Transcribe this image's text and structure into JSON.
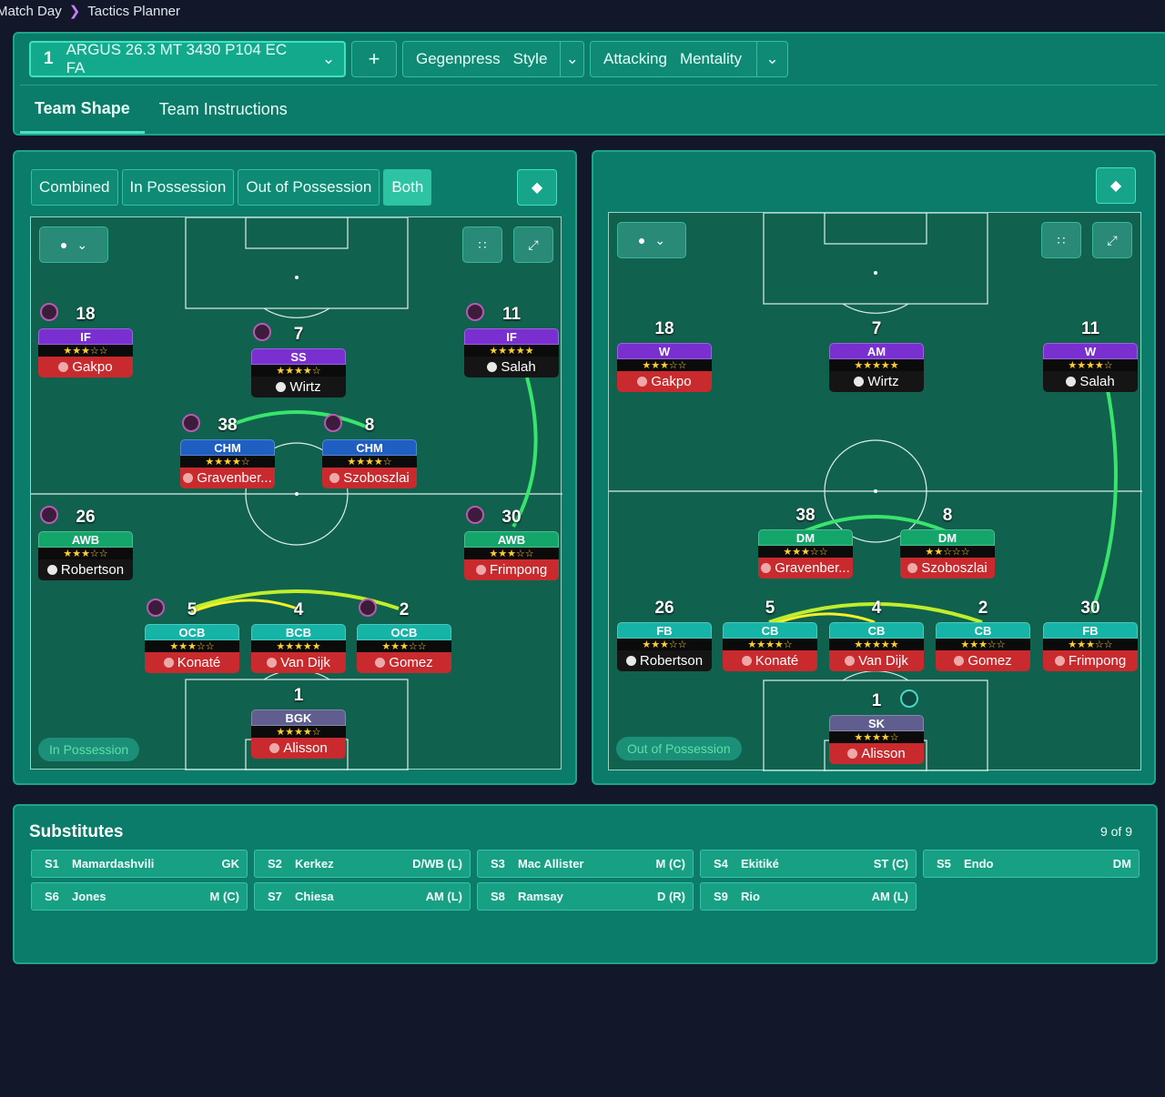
{
  "breadcrumb": {
    "parent": "Match Day",
    "current": "Tactics Planner"
  },
  "toolbar": {
    "tactic_slot": "1",
    "tactic_name": "ARGUS 26.3 MT 3430 P104 EC FA",
    "add_label": "+",
    "style_value": "Gegenpress",
    "style_label": "Style",
    "mentality_value": "Attacking",
    "mentality_label": "Mentality"
  },
  "tabs": {
    "team_shape": "Team Shape",
    "team_instructions": "Team Instructions"
  },
  "view_modes": {
    "combined": "Combined",
    "in_possession": "In Possession",
    "out_of_possession": "Out of Possession",
    "both": "Both"
  },
  "left_pitch": {
    "phase_label": "In Possession",
    "players": [
      {
        "num": "18",
        "role": "IF",
        "stars": "★★★☆☆",
        "name": "Gakpo"
      },
      {
        "num": "7",
        "role": "SS",
        "stars": "★★★★☆",
        "name": "Wirtz"
      },
      {
        "num": "11",
        "role": "IF",
        "stars": "★★★★★",
        "name": "Salah"
      },
      {
        "num": "38",
        "role": "CHM",
        "stars": "★★★★☆",
        "name": "Gravenber..."
      },
      {
        "num": "8",
        "role": "CHM",
        "stars": "★★★★☆",
        "name": "Szoboszlai"
      },
      {
        "num": "26",
        "role": "AWB",
        "stars": "★★★☆☆",
        "name": "Robertson"
      },
      {
        "num": "30",
        "role": "AWB",
        "stars": "★★★☆☆",
        "name": "Frimpong"
      },
      {
        "num": "5",
        "role": "OCB",
        "stars": "★★★☆☆",
        "name": "Konaté"
      },
      {
        "num": "4",
        "role": "BCB",
        "stars": "★★★★★",
        "name": "Van Dijk"
      },
      {
        "num": "2",
        "role": "OCB",
        "stars": "★★★☆☆",
        "name": "Gomez"
      },
      {
        "num": "1",
        "role": "BGK",
        "stars": "★★★★☆",
        "name": "Alisson"
      }
    ]
  },
  "right_pitch": {
    "phase_label": "Out of Possession",
    "players": [
      {
        "num": "18",
        "role": "W",
        "stars": "★★★☆☆",
        "name": "Gakpo"
      },
      {
        "num": "7",
        "role": "AM",
        "stars": "★★★★★",
        "name": "Wirtz"
      },
      {
        "num": "11",
        "role": "W",
        "stars": "★★★★☆",
        "name": "Salah"
      },
      {
        "num": "38",
        "role": "DM",
        "stars": "★★★☆☆",
        "name": "Gravenber..."
      },
      {
        "num": "8",
        "role": "DM",
        "stars": "★★☆☆☆",
        "name": "Szoboszlai"
      },
      {
        "num": "26",
        "role": "FB",
        "stars": "★★★☆☆",
        "name": "Robertson"
      },
      {
        "num": "5",
        "role": "CB",
        "stars": "★★★★☆",
        "name": "Konaté"
      },
      {
        "num": "4",
        "role": "CB",
        "stars": "★★★★★",
        "name": "Van Dijk"
      },
      {
        "num": "2",
        "role": "CB",
        "stars": "★★★☆☆",
        "name": "Gomez"
      },
      {
        "num": "30",
        "role": "FB",
        "stars": "★★★☆☆",
        "name": "Frimpong"
      },
      {
        "num": "1",
        "role": "SK",
        "stars": "★★★★☆",
        "name": "Alisson"
      }
    ]
  },
  "substitutes": {
    "title": "Substitutes",
    "count": "9 of 9",
    "items": [
      {
        "id": "S1",
        "name": "Mamardashvili",
        "pos": "GK"
      },
      {
        "id": "S2",
        "name": "Kerkez",
        "pos": "D/WB (L)"
      },
      {
        "id": "S3",
        "name": "Mac Allister",
        "pos": "M (C)"
      },
      {
        "id": "S4",
        "name": "Ekitiké",
        "pos": "ST (C)"
      },
      {
        "id": "S5",
        "name": "Endo",
        "pos": "DM"
      },
      {
        "id": "S6",
        "name": "Jones",
        "pos": "M (C)"
      },
      {
        "id": "S7",
        "name": "Chiesa",
        "pos": "AM (L)"
      },
      {
        "id": "S8",
        "name": "Ramsay",
        "pos": "D (R)"
      },
      {
        "id": "S9",
        "name": "Rio",
        "pos": "AM (L)"
      }
    ]
  },
  "icons": {
    "eye": "eye-icon",
    "chevron": "chevron-down-icon",
    "grid": "grid-icon",
    "expand": "expand-icon",
    "pin": "tactic-icon"
  },
  "colors": {
    "panel": "#0b7c6a",
    "pitch": "#11614f",
    "accent": "#2dc4a4",
    "name_red": "#c82a2e"
  }
}
